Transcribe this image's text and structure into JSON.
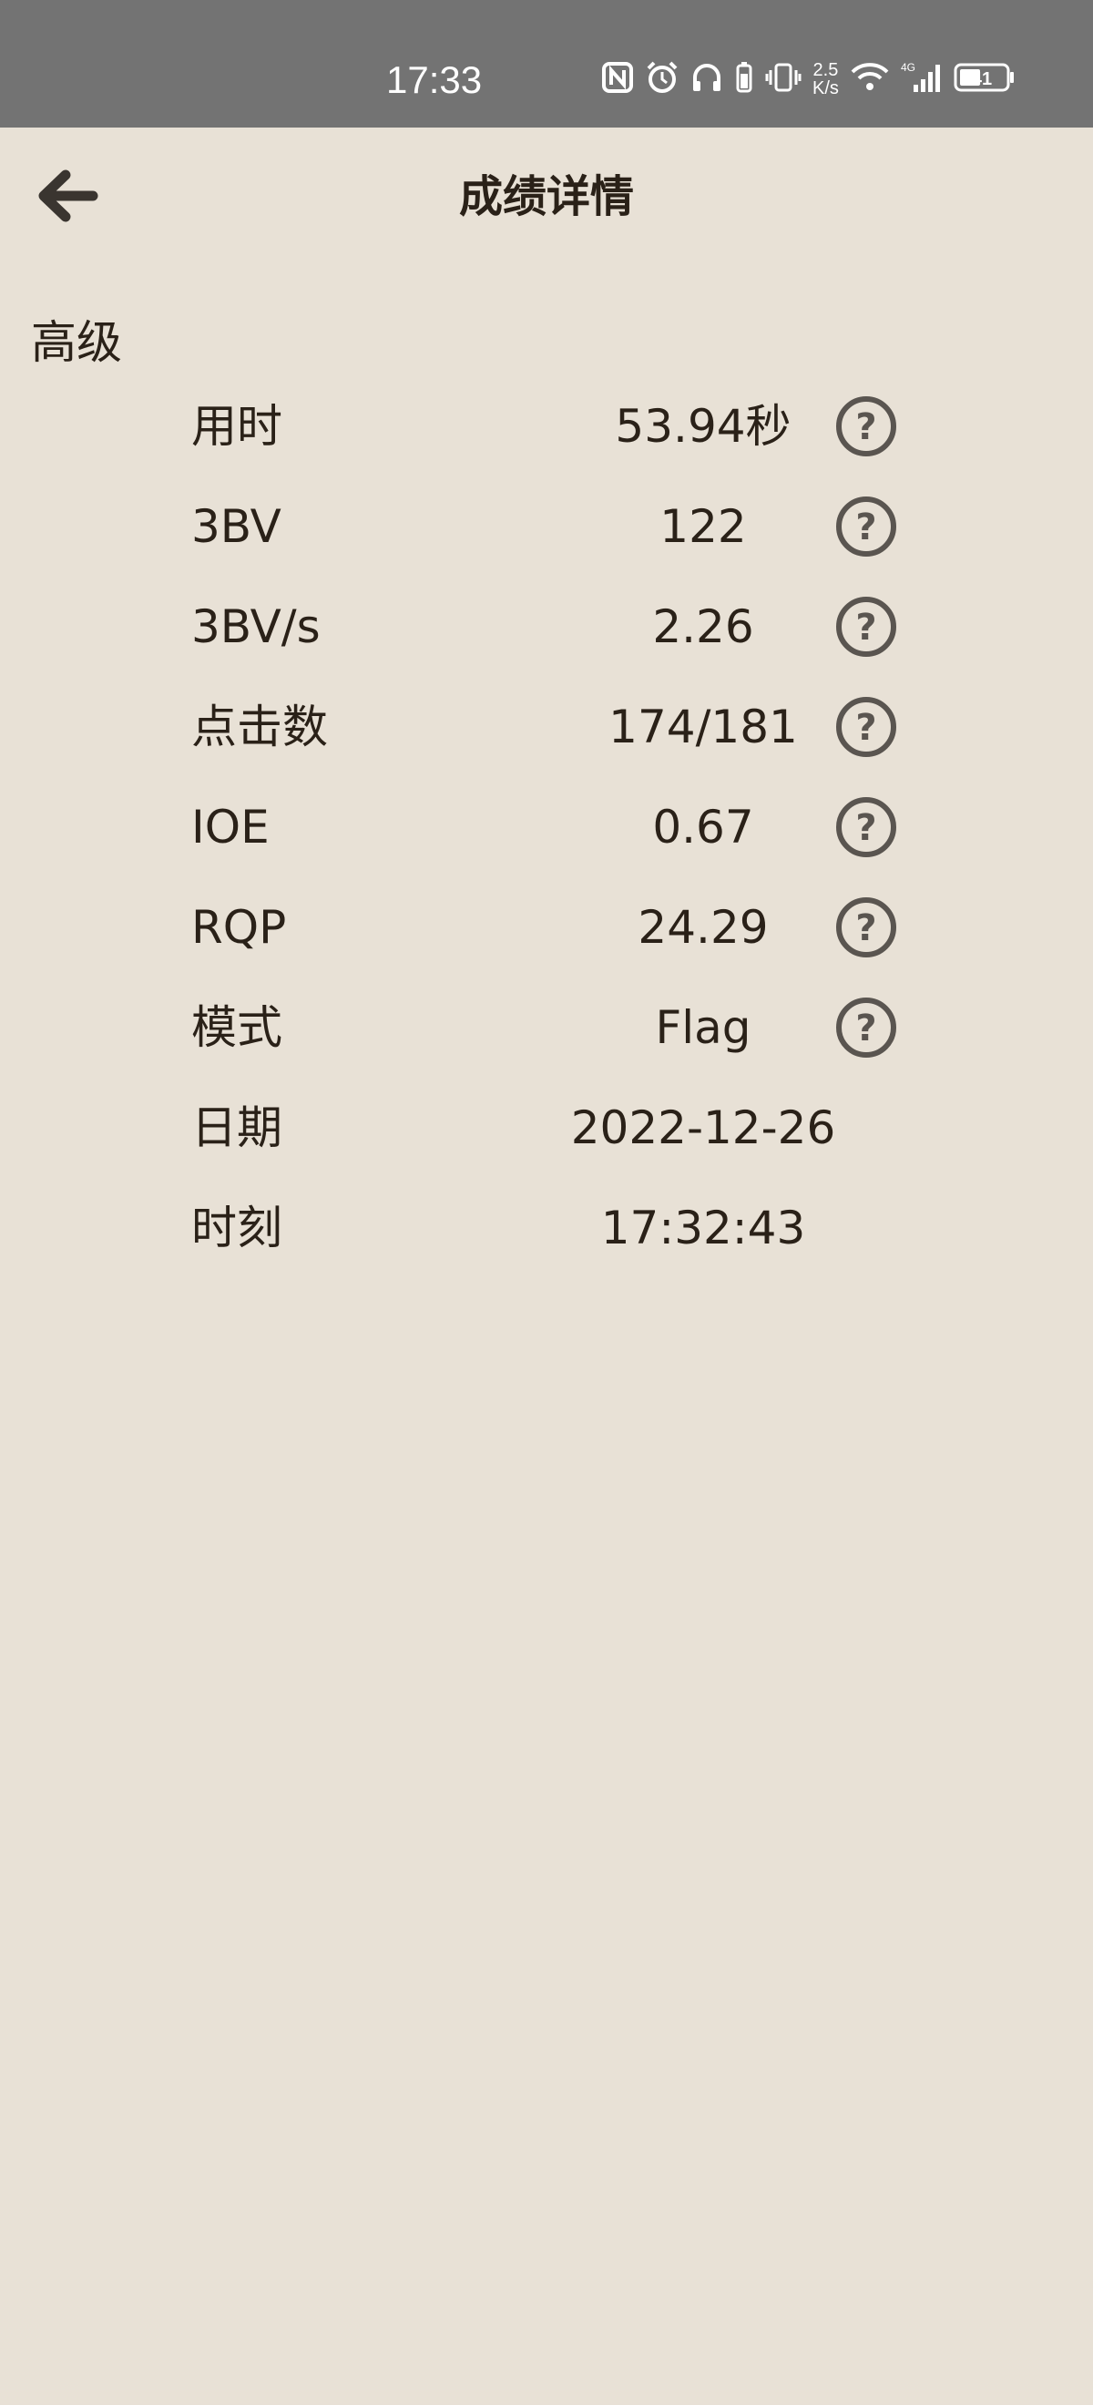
{
  "status_bar": {
    "time": "17:33",
    "speed_top": "2.5",
    "speed_bottom": "K/s",
    "network": "4G",
    "battery": "41",
    "icons": [
      "nfc-icon",
      "alarm-icon",
      "headphones-icon",
      "battery-small-icon",
      "vibrate-icon",
      "wifi-icon",
      "signal-icon",
      "battery-icon"
    ]
  },
  "header": {
    "back_icon": "arrow-left-icon",
    "title": "成绩详情"
  },
  "section": {
    "title": "高级"
  },
  "rows": [
    {
      "label": "用时",
      "value": "53.94秒",
      "help": true
    },
    {
      "label": "3BV",
      "value": "122",
      "help": true
    },
    {
      "label": "3BV/s",
      "value": "2.26",
      "help": true
    },
    {
      "label": "点击数",
      "value": "174/181",
      "help": true
    },
    {
      "label": "IOE",
      "value": "0.67",
      "help": true
    },
    {
      "label": "RQP",
      "value": "24.29",
      "help": true
    },
    {
      "label": "模式",
      "value": "Flag",
      "help": true
    },
    {
      "label": "日期",
      "value": "2022-12-26",
      "help": false
    },
    {
      "label": "时刻",
      "value": "17:32:43",
      "help": false
    }
  ],
  "colors": {
    "background": "#e8e1d6",
    "status_bar": "#737373",
    "text": "#2a2118",
    "help_icon": "#5a5550"
  }
}
